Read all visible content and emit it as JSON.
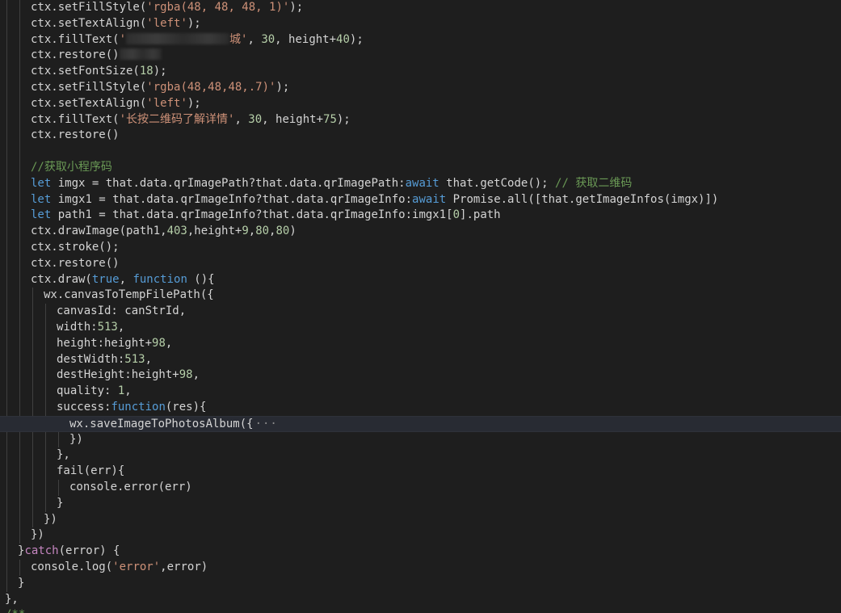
{
  "theme": {
    "background": "#1e1e1e",
    "text": "#d4d4d4",
    "string": "#ce9178",
    "number": "#b5cea8",
    "keyword": "#569cd6",
    "comment": "#6a9955",
    "control": "#c586c0",
    "highlight_line": "#282b33",
    "indent_guide": "#404040"
  },
  "code_lines": [
    {
      "indent": 2,
      "tokens": [
        {
          "t": "ctx.setFillStyle(",
          "k": "p"
        },
        {
          "t": "'rgba(48, 48, 48, 1)'",
          "k": "s"
        },
        {
          "t": ");",
          "k": "p"
        }
      ]
    },
    {
      "indent": 2,
      "tokens": [
        {
          "t": "ctx.setTextAlign(",
          "k": "p"
        },
        {
          "t": "'left'",
          "k": "s"
        },
        {
          "t": ");",
          "k": "p"
        }
      ]
    },
    {
      "indent": 2,
      "tokens": [
        {
          "t": "ctx.fillText(",
          "k": "p"
        },
        {
          "t": "'",
          "k": "s"
        },
        {
          "t": "",
          "k": "blur",
          "w": 128
        },
        {
          "t": "城'",
          "k": "s"
        },
        {
          "t": ", ",
          "k": "p"
        },
        {
          "t": "30",
          "k": "n"
        },
        {
          "t": ", height+",
          "k": "p"
        },
        {
          "t": "40",
          "k": "n"
        },
        {
          "t": ");",
          "k": "p"
        }
      ]
    },
    {
      "indent": 2,
      "tokens": [
        {
          "t": "ctx.restore()",
          "k": "p"
        },
        {
          "t": "",
          "k": "blur",
          "w": 52
        }
      ]
    },
    {
      "indent": 2,
      "tokens": [
        {
          "t": "ctx.setFontSize(",
          "k": "p"
        },
        {
          "t": "18",
          "k": "n"
        },
        {
          "t": ");",
          "k": "p"
        }
      ]
    },
    {
      "indent": 2,
      "tokens": [
        {
          "t": "ctx.setFillStyle(",
          "k": "p"
        },
        {
          "t": "'rgba(48,48,48,.7)'",
          "k": "s"
        },
        {
          "t": ");",
          "k": "p"
        }
      ]
    },
    {
      "indent": 2,
      "tokens": [
        {
          "t": "ctx.setTextAlign(",
          "k": "p"
        },
        {
          "t": "'left'",
          "k": "s"
        },
        {
          "t": ");",
          "k": "p"
        }
      ]
    },
    {
      "indent": 2,
      "tokens": [
        {
          "t": "ctx.fillText(",
          "k": "p"
        },
        {
          "t": "'长按二维码了解详情'",
          "k": "s"
        },
        {
          "t": ", ",
          "k": "p"
        },
        {
          "t": "30",
          "k": "n"
        },
        {
          "t": ", height+",
          "k": "p"
        },
        {
          "t": "75",
          "k": "n"
        },
        {
          "t": ");",
          "k": "p"
        }
      ]
    },
    {
      "indent": 2,
      "tokens": [
        {
          "t": "ctx.restore()",
          "k": "p"
        }
      ]
    },
    {
      "indent": 2,
      "tokens": []
    },
    {
      "indent": 2,
      "tokens": [
        {
          "t": "//获取小程序码",
          "k": "c"
        }
      ]
    },
    {
      "indent": 2,
      "tokens": [
        {
          "t": "let",
          "k": "k"
        },
        {
          "t": " imgx = that.data.qrImagePath?that.data.qrImagePath:",
          "k": "p"
        },
        {
          "t": "await",
          "k": "k"
        },
        {
          "t": " that.getCode(); ",
          "k": "p"
        },
        {
          "t": "// 获取二维码",
          "k": "c"
        }
      ]
    },
    {
      "indent": 2,
      "tokens": [
        {
          "t": "let",
          "k": "k"
        },
        {
          "t": " imgx1 = that.data.qrImageInfo?that.data.qrImageInfo:",
          "k": "p"
        },
        {
          "t": "await",
          "k": "k"
        },
        {
          "t": " Promise.all([that.getImageInfos(imgx)])",
          "k": "p"
        }
      ]
    },
    {
      "indent": 2,
      "tokens": [
        {
          "t": "let",
          "k": "k"
        },
        {
          "t": " path1 = that.data.qrImageInfo?that.data.qrImageInfo:imgx1[",
          "k": "p"
        },
        {
          "t": "0",
          "k": "n"
        },
        {
          "t": "].path",
          "k": "p"
        }
      ]
    },
    {
      "indent": 2,
      "tokens": [
        {
          "t": "ctx.drawImage(path1,",
          "k": "p"
        },
        {
          "t": "403",
          "k": "n"
        },
        {
          "t": ",height+",
          "k": "p"
        },
        {
          "t": "9",
          "k": "n"
        },
        {
          "t": ",",
          "k": "p"
        },
        {
          "t": "80",
          "k": "n"
        },
        {
          "t": ",",
          "k": "p"
        },
        {
          "t": "80",
          "k": "n"
        },
        {
          "t": ")",
          "k": "p"
        }
      ]
    },
    {
      "indent": 2,
      "tokens": [
        {
          "t": "ctx.stroke();",
          "k": "p"
        }
      ]
    },
    {
      "indent": 2,
      "tokens": [
        {
          "t": "ctx.restore()",
          "k": "p"
        }
      ]
    },
    {
      "indent": 2,
      "tokens": [
        {
          "t": "ctx.draw(",
          "k": "p"
        },
        {
          "t": "true",
          "k": "k"
        },
        {
          "t": ", ",
          "k": "p"
        },
        {
          "t": "function",
          "k": "k"
        },
        {
          "t": " (){",
          "k": "p"
        }
      ]
    },
    {
      "indent": 3,
      "tokens": [
        {
          "t": "wx.canvasToTempFilePath({",
          "k": "p"
        }
      ]
    },
    {
      "indent": 4,
      "tokens": [
        {
          "t": "canvasId: canStrId,",
          "k": "p"
        }
      ]
    },
    {
      "indent": 4,
      "tokens": [
        {
          "t": "width:",
          "k": "p"
        },
        {
          "t": "513",
          "k": "n"
        },
        {
          "t": ",",
          "k": "p"
        }
      ]
    },
    {
      "indent": 4,
      "tokens": [
        {
          "t": "height:height+",
          "k": "p"
        },
        {
          "t": "98",
          "k": "n"
        },
        {
          "t": ",",
          "k": "p"
        }
      ]
    },
    {
      "indent": 4,
      "tokens": [
        {
          "t": "destWidth:",
          "k": "p"
        },
        {
          "t": "513",
          "k": "n"
        },
        {
          "t": ",",
          "k": "p"
        }
      ]
    },
    {
      "indent": 4,
      "tokens": [
        {
          "t": "destHeight:height+",
          "k": "p"
        },
        {
          "t": "98",
          "k": "n"
        },
        {
          "t": ",",
          "k": "p"
        }
      ]
    },
    {
      "indent": 4,
      "tokens": [
        {
          "t": "quality: ",
          "k": "p"
        },
        {
          "t": "1",
          "k": "n"
        },
        {
          "t": ",",
          "k": "p"
        }
      ]
    },
    {
      "indent": 4,
      "tokens": [
        {
          "t": "success:",
          "k": "p"
        },
        {
          "t": "function",
          "k": "k"
        },
        {
          "t": "(res){",
          "k": "p"
        }
      ]
    },
    {
      "indent": 5,
      "highlight": true,
      "tokens": [
        {
          "t": "wx.saveImageToPhotosAlbum({",
          "k": "p"
        },
        {
          "t": "···",
          "k": "fold"
        }
      ]
    },
    {
      "indent": 5,
      "tokens": [
        {
          "t": "})",
          "k": "p"
        }
      ]
    },
    {
      "indent": 4,
      "tokens": [
        {
          "t": "},",
          "k": "p"
        }
      ]
    },
    {
      "indent": 4,
      "tokens": [
        {
          "t": "fail(err){",
          "k": "p"
        }
      ]
    },
    {
      "indent": 5,
      "tokens": [
        {
          "t": "console.error(err)",
          "k": "p"
        }
      ]
    },
    {
      "indent": 4,
      "tokens": [
        {
          "t": "}",
          "k": "p"
        }
      ]
    },
    {
      "indent": 3,
      "tokens": [
        {
          "t": "})",
          "k": "p"
        }
      ]
    },
    {
      "indent": 2,
      "tokens": [
        {
          "t": "})",
          "k": "p"
        }
      ]
    },
    {
      "indent": 1,
      "tokens": [
        {
          "t": "}",
          "k": "p"
        },
        {
          "t": "catch",
          "k": "x"
        },
        {
          "t": "(error) {",
          "k": "p"
        }
      ]
    },
    {
      "indent": 2,
      "tokens": [
        {
          "t": "console.log(",
          "k": "p"
        },
        {
          "t": "'error'",
          "k": "s"
        },
        {
          "t": ",error)",
          "k": "p"
        }
      ]
    },
    {
      "indent": 1,
      "tokens": [
        {
          "t": "}",
          "k": "p"
        }
      ]
    },
    {
      "indent": 0,
      "tokens": [
        {
          "t": "},",
          "k": "p"
        }
      ]
    },
    {
      "indent": 0,
      "tokens": [
        {
          "t": "/**",
          "k": "c"
        }
      ]
    }
  ]
}
